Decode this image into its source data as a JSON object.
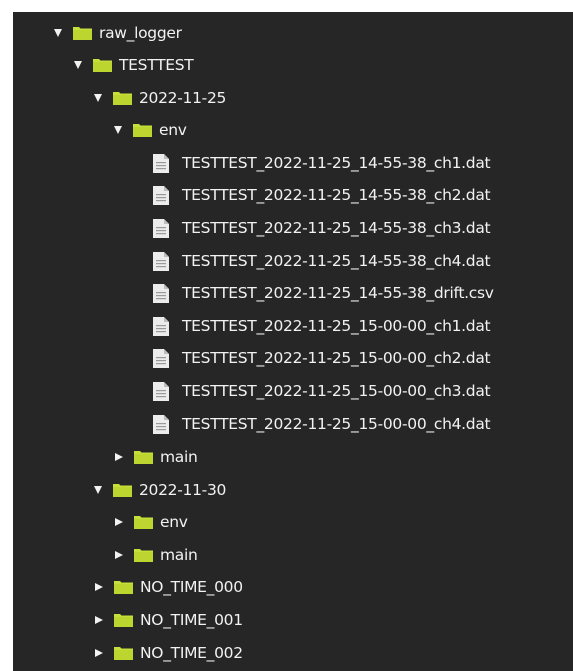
{
  "colors": {
    "background": "#262626",
    "text": "#f2f2f2",
    "folder": "#c7df3a",
    "file_icon": "#ececec"
  },
  "tree": {
    "root": {
      "label": "raw_logger",
      "expanded": true,
      "icon": "folder-icon"
    },
    "project": {
      "label": "TESTTEST",
      "expanded": true,
      "icon": "folder-icon"
    },
    "date_1": {
      "label": "2022-11-25",
      "expanded": true,
      "icon": "folder-icon"
    },
    "date_1_env": {
      "label": "env",
      "expanded": true,
      "icon": "folder-icon"
    },
    "files": [
      {
        "label": "TESTTEST_2022-11-25_14-55-38_ch1.dat",
        "icon": "file-icon"
      },
      {
        "label": "TESTTEST_2022-11-25_14-55-38_ch2.dat",
        "icon": "file-icon"
      },
      {
        "label": "TESTTEST_2022-11-25_14-55-38_ch3.dat",
        "icon": "file-icon"
      },
      {
        "label": "TESTTEST_2022-11-25_14-55-38_ch4.dat",
        "icon": "file-icon"
      },
      {
        "label": "TESTTEST_2022-11-25_14-55-38_drift.csv",
        "icon": "file-icon"
      },
      {
        "label": "TESTTEST_2022-11-25_15-00-00_ch1.dat",
        "icon": "file-icon"
      },
      {
        "label": "TESTTEST_2022-11-25_15-00-00_ch2.dat",
        "icon": "file-icon"
      },
      {
        "label": "TESTTEST_2022-11-25_15-00-00_ch3.dat",
        "icon": "file-icon"
      },
      {
        "label": "TESTTEST_2022-11-25_15-00-00_ch4.dat",
        "icon": "file-icon"
      }
    ],
    "date_1_main": {
      "label": "main",
      "expanded": false,
      "icon": "folder-icon"
    },
    "date_2": {
      "label": "2022-11-30",
      "expanded": true,
      "icon": "folder-icon"
    },
    "date_2_env": {
      "label": "env",
      "expanded": false,
      "icon": "folder-icon"
    },
    "date_2_main": {
      "label": "main",
      "expanded": false,
      "icon": "folder-icon"
    },
    "no_time_000": {
      "label": "NO_TIME_000",
      "expanded": false,
      "icon": "folder-icon"
    },
    "no_time_001": {
      "label": "NO_TIME_001",
      "expanded": false,
      "icon": "folder-icon"
    },
    "no_time_002": {
      "label": "NO_TIME_002",
      "expanded": false,
      "icon": "folder-icon"
    }
  }
}
